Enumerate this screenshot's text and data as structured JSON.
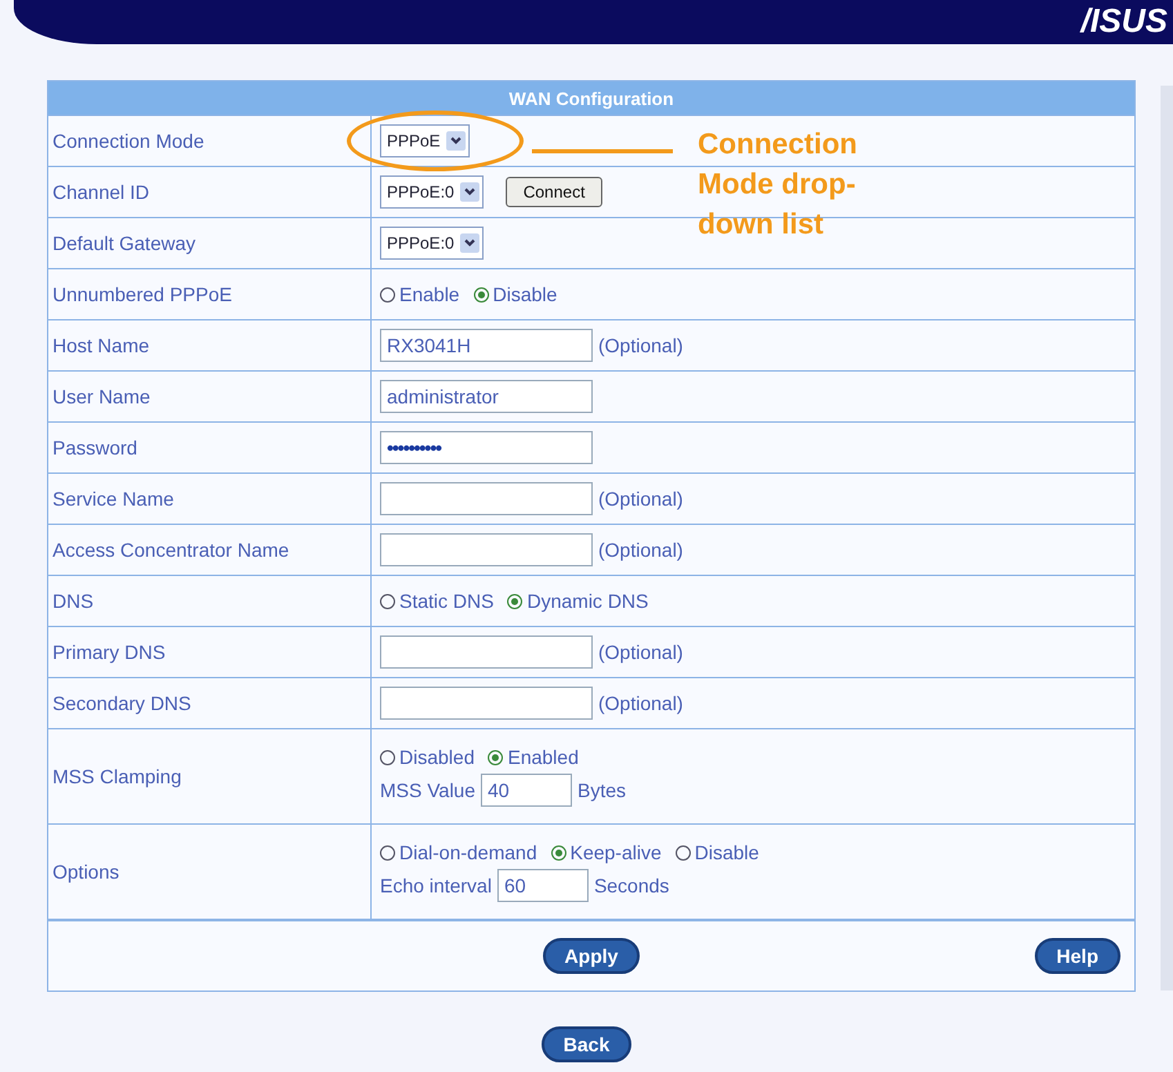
{
  "header": {
    "logo": "/ISUS"
  },
  "table": {
    "title": "WAN Configuration",
    "rows": [
      {
        "label": "Connection Mode",
        "lines": [
          [
            {
              "kind": "select",
              "value": "PPPoE"
            }
          ]
        ]
      },
      {
        "label": "Channel ID",
        "lines": [
          [
            {
              "kind": "select",
              "value": "PPPoE:0"
            },
            {
              "kind": "button",
              "label": "Connect"
            }
          ]
        ]
      },
      {
        "label": "Default Gateway",
        "lines": [
          [
            {
              "kind": "select",
              "value": "PPPoE:0"
            }
          ]
        ]
      },
      {
        "label": "Unnumbered PPPoE",
        "lines": [
          [
            {
              "kind": "radio",
              "label": "Enable",
              "selected": false
            },
            {
              "kind": "radio",
              "label": "Disable",
              "selected": true
            }
          ]
        ]
      },
      {
        "label": "Host Name",
        "lines": [
          [
            {
              "kind": "input",
              "value": "RX3041H"
            },
            {
              "kind": "note",
              "text": "(Optional)"
            }
          ]
        ]
      },
      {
        "label": "User Name",
        "lines": [
          [
            {
              "kind": "input",
              "value": "administrator"
            }
          ]
        ]
      },
      {
        "label": "Password",
        "lines": [
          [
            {
              "kind": "password",
              "value": "••••••••••"
            }
          ]
        ]
      },
      {
        "label": "Service Name",
        "lines": [
          [
            {
              "kind": "input"
            },
            {
              "kind": "note",
              "text": "(Optional)"
            }
          ]
        ]
      },
      {
        "label": "Access Concentrator Name",
        "lines": [
          [
            {
              "kind": "input"
            },
            {
              "kind": "note",
              "text": "(Optional)"
            }
          ]
        ]
      },
      {
        "label": "DNS",
        "lines": [
          [
            {
              "kind": "radio",
              "label": "Static DNS",
              "selected": false
            },
            {
              "kind": "radio",
              "label": "Dynamic DNS",
              "selected": true
            }
          ]
        ]
      },
      {
        "label": "Primary DNS",
        "lines": [
          [
            {
              "kind": "input"
            },
            {
              "kind": "note",
              "text": "(Optional)"
            }
          ]
        ]
      },
      {
        "label": "Secondary DNS",
        "lines": [
          [
            {
              "kind": "input"
            },
            {
              "kind": "note",
              "text": "(Optional)"
            }
          ]
        ]
      },
      {
        "label": "MSS Clamping",
        "lines": [
          [
            {
              "kind": "radio",
              "label": "Disabled",
              "selected": false
            },
            {
              "kind": "radio",
              "label": "Enabled",
              "selected": true
            }
          ],
          [
            {
              "kind": "text",
              "text": "MSS Value"
            },
            {
              "kind": "small_input",
              "value": "40"
            },
            {
              "kind": "text",
              "text": "Bytes"
            }
          ]
        ]
      },
      {
        "label": "Options",
        "lines": [
          [
            {
              "kind": "radio",
              "label": "Dial-on-demand",
              "selected": false
            },
            {
              "kind": "radio",
              "label": "Keep-alive",
              "selected": true
            },
            {
              "kind": "radio",
              "label": "Disable",
              "selected": false
            }
          ],
          [
            {
              "kind": "text",
              "text": "Echo interval"
            },
            {
              "kind": "small_input",
              "value": "60"
            },
            {
              "kind": "text",
              "text": "Seconds"
            }
          ]
        ]
      }
    ],
    "apply": "Apply",
    "help": "Help"
  },
  "back": "Back",
  "callout": {
    "text": "Connection Mode drop-down list"
  }
}
